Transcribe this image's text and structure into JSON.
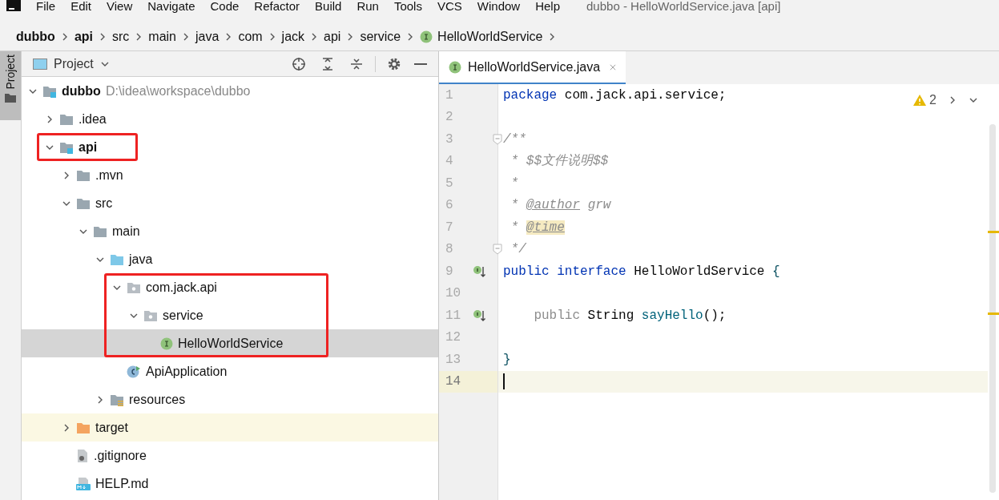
{
  "menu_bar": {
    "items": [
      "File",
      "Edit",
      "View",
      "Navigate",
      "Code",
      "Refactor",
      "Build",
      "Run",
      "Tools",
      "VCS",
      "Window",
      "Help"
    ],
    "title": "dubbo - HelloWorldService.java [api]"
  },
  "breadcrumbs": [
    {
      "label": "dubbo",
      "bold": true
    },
    {
      "label": "api",
      "bold": true
    },
    {
      "label": "src",
      "bold": false
    },
    {
      "label": "main",
      "bold": false
    },
    {
      "label": "java",
      "bold": false
    },
    {
      "label": "com",
      "bold": false
    },
    {
      "label": "jack",
      "bold": false
    },
    {
      "label": "api",
      "bold": false
    },
    {
      "label": "service",
      "bold": false
    },
    {
      "label": "HelloWorldService",
      "bold": false
    }
  ],
  "side_strip": {
    "label": "Project"
  },
  "project_panel": {
    "title": "Project",
    "tree": [
      {
        "label": "dubbo",
        "hint": "D:\\idea\\workspace\\dubbo",
        "kind": "module",
        "bold": true,
        "expanded": true,
        "selected": false,
        "excluded": false,
        "framed": false,
        "children": [
          {
            "label": ".idea",
            "kind": "folder",
            "bold": false,
            "expanded": false,
            "selected": false,
            "excluded": false,
            "framed": false
          },
          {
            "label": "api",
            "kind": "module",
            "bold": true,
            "expanded": true,
            "selected": false,
            "excluded": false,
            "framed": true,
            "children": [
              {
                "label": ".mvn",
                "kind": "folder",
                "bold": false,
                "expanded": false,
                "selected": false,
                "excluded": false,
                "framed": false
              },
              {
                "label": "src",
                "kind": "folder",
                "bold": false,
                "expanded": true,
                "selected": false,
                "excluded": false,
                "framed": false,
                "children": [
                  {
                    "label": "main",
                    "kind": "folder",
                    "bold": false,
                    "expanded": true,
                    "selected": false,
                    "excluded": false,
                    "framed": false,
                    "children": [
                      {
                        "label": "java",
                        "kind": "source",
                        "bold": false,
                        "expanded": true,
                        "selected": false,
                        "excluded": false,
                        "framed": false,
                        "children": [
                          {
                            "label": "com.jack.api",
                            "kind": "package",
                            "bold": false,
                            "expanded": true,
                            "selected": false,
                            "excluded": false,
                            "framed": true,
                            "children": [
                              {
                                "label": "service",
                                "kind": "package",
                                "bold": false,
                                "expanded": true,
                                "selected": false,
                                "excluded": false,
                                "framed": true,
                                "children": [
                                  {
                                    "label": "HelloWorldService",
                                    "kind": "interface",
                                    "bold": false,
                                    "selected": true,
                                    "excluded": false,
                                    "framed": true
                                  }
                                ]
                              }
                            ]
                          },
                          {
                            "label": "ApiApplication",
                            "kind": "app",
                            "bold": false,
                            "selected": false,
                            "excluded": false,
                            "framed": false
                          }
                        ]
                      },
                      {
                        "label": "resources",
                        "kind": "resources",
                        "bold": false,
                        "expanded": false,
                        "selected": false,
                        "excluded": false,
                        "framed": false
                      }
                    ]
                  }
                ]
              },
              {
                "label": "target",
                "kind": "excluded",
                "bold": false,
                "expanded": false,
                "selected": false,
                "excluded": true,
                "framed": false
              },
              {
                "label": ".gitignore",
                "kind": "file",
                "bold": false,
                "selected": false,
                "excluded": false,
                "framed": false
              },
              {
                "label": "HELP.md",
                "kind": "markdown",
                "bold": false,
                "selected": false,
                "excluded": false,
                "framed": false
              }
            ]
          }
        ]
      }
    ]
  },
  "editor": {
    "tab": {
      "label": "HelloWorldService.java",
      "selected": true
    },
    "warnings": "2",
    "lines": [
      {
        "number": "1",
        "fold": false,
        "marker": false,
        "current": false,
        "tokens": [
          {
            "kind": "keyword",
            "text": "package"
          },
          {
            "kind": "plain",
            "text": " com.jack.api.service;"
          }
        ]
      },
      {
        "number": "2",
        "fold": false,
        "marker": false,
        "current": false
      },
      {
        "number": "3",
        "fold": true,
        "marker": false,
        "current": false,
        "tokens": [
          {
            "kind": "comment",
            "text": "/**"
          }
        ]
      },
      {
        "number": "4",
        "fold": false,
        "marker": false,
        "current": false,
        "tokens": [
          {
            "kind": "comment",
            "text": " * $$文件说明$$"
          }
        ]
      },
      {
        "number": "5",
        "fold": false,
        "marker": false,
        "current": false,
        "tokens": [
          {
            "kind": "comment",
            "text": " *"
          }
        ]
      },
      {
        "number": "6",
        "fold": false,
        "marker": false,
        "current": false,
        "tokens": [
          {
            "kind": "comment",
            "text": " * "
          },
          {
            "kind": "tag",
            "text": "@author"
          },
          {
            "kind": "comment",
            "text": " grw"
          }
        ]
      },
      {
        "number": "7",
        "fold": false,
        "marker": false,
        "current": false,
        "tokens": [
          {
            "kind": "comment",
            "text": " * "
          },
          {
            "kind": "tag-warn",
            "text": "@time"
          }
        ]
      },
      {
        "number": "8",
        "fold": true,
        "marker": false,
        "current": false,
        "tokens": [
          {
            "kind": "comment",
            "text": " */"
          }
        ]
      },
      {
        "number": "9",
        "fold": false,
        "marker": true,
        "current": false,
        "tokens": [
          {
            "kind": "keyword",
            "text": "public"
          },
          {
            "kind": "keyword",
            "text": " interface"
          },
          {
            "kind": "plain",
            "text": " HelloWorldService "
          },
          {
            "kind": "brace",
            "text": "{"
          }
        ]
      },
      {
        "number": "10",
        "fold": false,
        "marker": false,
        "current": false
      },
      {
        "number": "11",
        "fold": false,
        "marker": true,
        "current": false,
        "tokens": [
          {
            "kind": "muted",
            "text": "    public"
          },
          {
            "kind": "plain",
            "text": " String "
          },
          {
            "kind": "method",
            "text": "sayHello"
          },
          {
            "kind": "plain",
            "text": "();"
          }
        ]
      },
      {
        "number": "12",
        "fold": false,
        "marker": false,
        "current": false
      },
      {
        "number": "13",
        "fold": false,
        "marker": false,
        "current": false,
        "tokens": [
          {
            "kind": "brace",
            "text": "}"
          }
        ]
      },
      {
        "number": "14",
        "fold": false,
        "marker": false,
        "current": true
      }
    ]
  }
}
